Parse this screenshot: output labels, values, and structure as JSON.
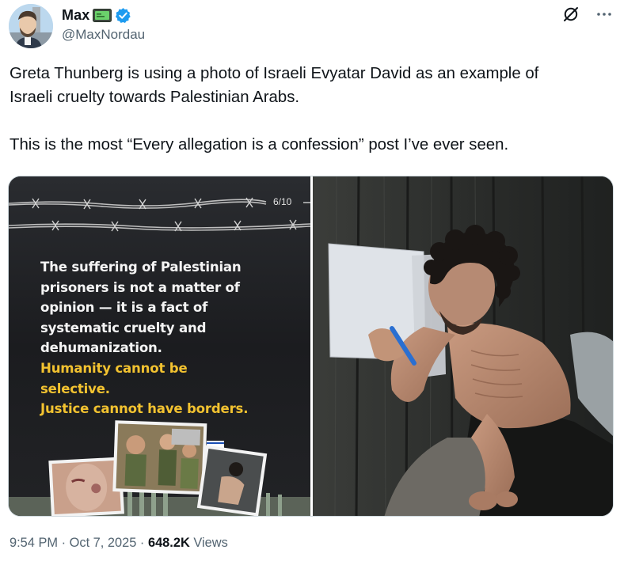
{
  "author": {
    "display_name": "Max",
    "handle": "@MaxNordau",
    "verified": true,
    "badge_icon": "dog-tag-emoji-icon",
    "verified_color": "#1d9bf0"
  },
  "topbar": {
    "grok_icon": "grok-icon",
    "more_icon": "more-horizontal-icon"
  },
  "tweet": {
    "line1": "Greta Thunberg is using a photo of Israeli Evyatar David as an example of",
    "line2": "Israeli cruelty towards Palestinian Arabs.",
    "line3": "This is the most “Every allegation is a confession” post I’ve ever seen."
  },
  "media": {
    "left": {
      "counter": "6/10",
      "quote_white": [
        "The suffering of Palestinian",
        "prisoners is not a matter of",
        "opinion — it is a fact of",
        "systematic cruelty and",
        "dehumanization."
      ],
      "quote_yellow": [
        "Humanity cannot be",
        "selective.",
        "Justice cannot have borders."
      ],
      "accent": "#f2c230"
    },
    "right": {
      "description_icon": "photo-of-emaciated-man-writing-on-paper"
    }
  },
  "meta": {
    "time": "9:54 PM",
    "sep1": " · ",
    "date": "Oct 7, 2025",
    "sep2": " · ",
    "views_count": "648.2K",
    "views_label": " Views"
  }
}
